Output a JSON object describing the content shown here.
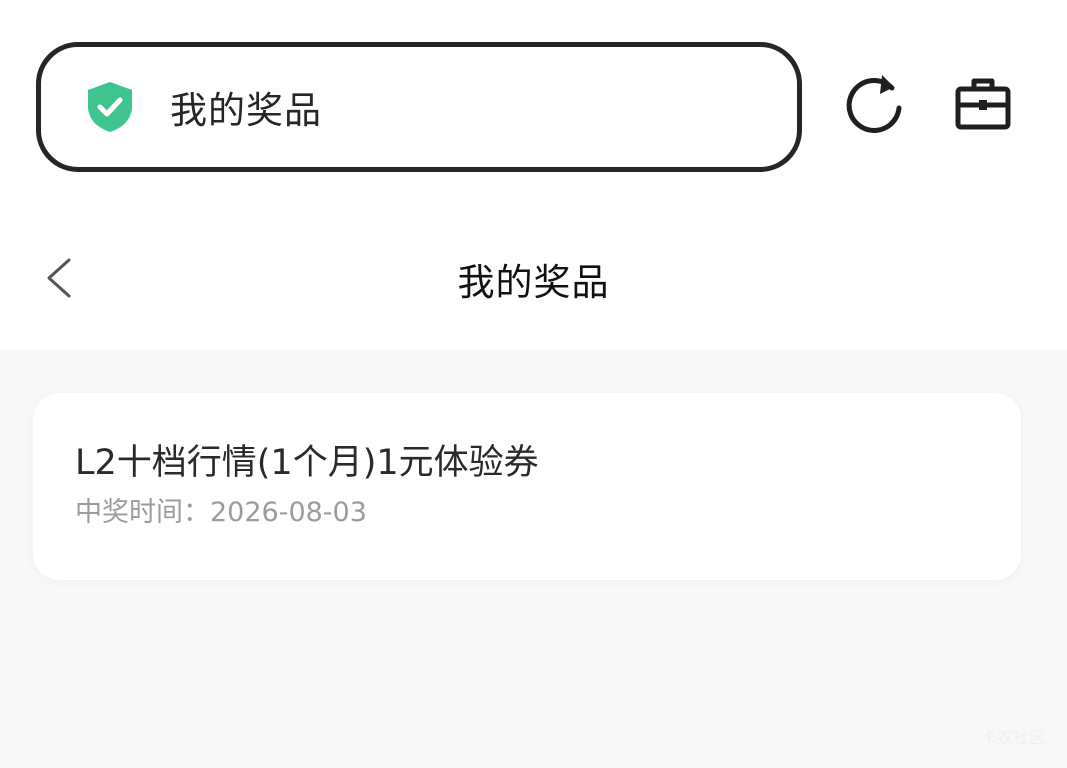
{
  "browser": {
    "address_text": "我的奖品",
    "secure_icon": "shield-check-icon",
    "refresh_icon": "refresh-icon",
    "toolbox_icon": "toolbox-icon",
    "accent_color": "#3ec48f"
  },
  "header": {
    "back_icon": "chevron-left-icon",
    "title": "我的奖品"
  },
  "prizes": [
    {
      "name": "L2十档行情(1个月)1元体验券",
      "time_label": "中奖时间：",
      "time_value": "2026-08-03"
    }
  ],
  "watermark": "卡农社区"
}
